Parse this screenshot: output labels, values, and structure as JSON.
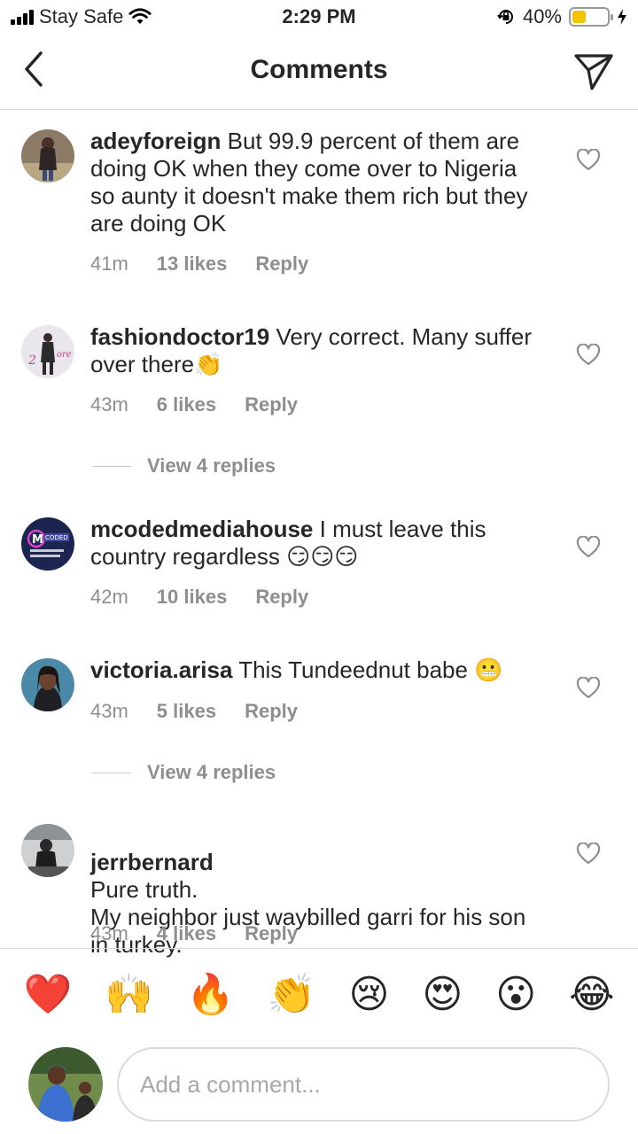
{
  "status_bar": {
    "carrier": "Stay Safe",
    "time": "2:29 PM",
    "battery_percent": "40%",
    "battery_level": 0.4,
    "icons": [
      "signal-icon",
      "wifi-icon",
      "orientation-lock-icon",
      "battery-icon",
      "charging-icon"
    ]
  },
  "header": {
    "title": "Comments",
    "back_icon": "chevron-left-icon",
    "share_icon": "send-icon"
  },
  "comments": [
    {
      "username": "adeyforeign",
      "text": "But 99.9 percent of them are doing OK when they come over to Nigeria so aunty it doesn't make them rich but they are doing OK",
      "time": "41m",
      "likes": "13 likes",
      "reply": "Reply"
    },
    {
      "username": "fashiondoctor19",
      "text": "Very correct. Many suffer over there👏",
      "time": "43m",
      "likes": "6 likes",
      "reply": "Reply",
      "view_replies": "View 4 replies"
    },
    {
      "username": "mcodedmediahouse",
      "text": "I must leave this country regardless 😏😏😏",
      "time": "42m",
      "likes": "10 likes",
      "reply": "Reply"
    },
    {
      "username": "victoria.arisa",
      "text": "This Tundeednut babe 😬",
      "time": "43m",
      "likes": "5 likes",
      "reply": "Reply",
      "view_replies": "View 4 replies"
    },
    {
      "username": "jerrbernard",
      "text": "Pure truth.\nMy neighbor just waybilled garri for his son in turkey.",
      "time": "43m",
      "likes": "4 likes",
      "reply": "Reply"
    }
  ],
  "reactions": [
    "❤️",
    "🙌",
    "🔥",
    "👏",
    "😢",
    "😍",
    "😮",
    "😂"
  ],
  "input": {
    "placeholder": "Add a comment..."
  },
  "colors": {
    "text": "#262626",
    "secondary": "#8e8e8e",
    "divider": "#dbdbdb",
    "battery": "#f2c400"
  }
}
